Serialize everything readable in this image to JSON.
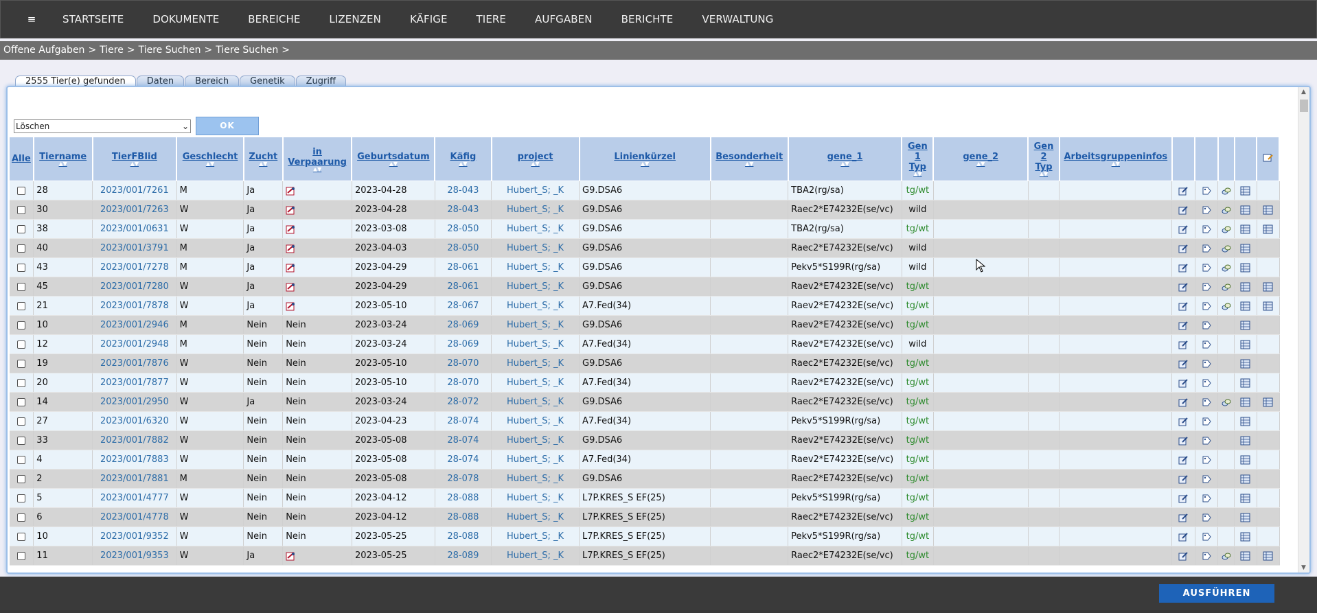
{
  "topnav": {
    "menu_icon": "≡",
    "items": [
      "STARTSEITE",
      "DOKUMENTE",
      "BEREICHE",
      "LIZENZEN",
      "KÄFIGE",
      "TIERE",
      "AUFGABEN",
      "BERICHTE",
      "VERWALTUNG"
    ]
  },
  "breadcrumb": [
    "Offene Aufgaben",
    "Tiere",
    "Tiere Suchen",
    "Tiere Suchen"
  ],
  "breadcrumb_sep": ">",
  "tabs": [
    "2555 Tier(e) gefunden",
    "Daten",
    "Bereich",
    "Genetik",
    "Zugriff"
  ],
  "action": {
    "selected": "Löschen",
    "ok_label": "OK"
  },
  "table": {
    "headers": [
      "Alle",
      "Tiername",
      "TierFBIid",
      "Geschlecht",
      "Zucht",
      "in Verpaarung",
      "Geburtsdatum",
      "Käfig",
      "project",
      "Linienkürzel",
      "Besonderheit",
      "gene_1",
      "Gen 1 Typ",
      "gene_2",
      "Gen 2 Typ",
      "Arbeitsgruppeninfos"
    ],
    "rows": [
      {
        "name": "28",
        "id": "2023/001/7261",
        "sex": "M",
        "zucht": "Ja",
        "verp": "icon",
        "birth": "2023-04-28",
        "cage": "28-043",
        "project": "Hubert_S; _K",
        "line": "G9.DSA6",
        "gene1": "TBA2(rg/sa)",
        "typ1": "tg/wt",
        "icons": 4
      },
      {
        "name": "30",
        "id": "2023/001/7263",
        "sex": "W",
        "zucht": "Ja",
        "verp": "icon",
        "birth": "2023-04-28",
        "cage": "28-043",
        "project": "Hubert_S; _K",
        "line": "G9.DSA6",
        "gene1": "Raec2*E74232E(se/vc)",
        "typ1": "wild",
        "icons": 5
      },
      {
        "name": "38",
        "id": "2023/001/0631",
        "sex": "W",
        "zucht": "Ja",
        "verp": "icon",
        "birth": "2023-03-08",
        "cage": "28-050",
        "project": "Hubert_S; _K",
        "line": "G9.DSA6",
        "gene1": "TBA2(rg/sa)",
        "typ1": "tg/wt",
        "icons": 5
      },
      {
        "name": "40",
        "id": "2023/001/3791",
        "sex": "M",
        "zucht": "Ja",
        "verp": "icon",
        "birth": "2023-04-03",
        "cage": "28-050",
        "project": "Hubert_S; _K",
        "line": "G9.DSA6",
        "gene1": "Raec2*E74232E(se/vc)",
        "typ1": "wild",
        "icons": 4
      },
      {
        "name": "43",
        "id": "2023/001/7278",
        "sex": "M",
        "zucht": "Ja",
        "verp": "icon",
        "birth": "2023-04-29",
        "cage": "28-061",
        "project": "Hubert_S; _K",
        "line": "G9.DSA6",
        "gene1": "Pekv5*S199R(rg/sa)",
        "typ1": "wild",
        "icons": 4
      },
      {
        "name": "45",
        "id": "2023/001/7280",
        "sex": "W",
        "zucht": "Ja",
        "verp": "icon",
        "birth": "2023-04-29",
        "cage": "28-061",
        "project": "Hubert_S; _K",
        "line": "G9.DSA6",
        "gene1": "Raev2*E74232E(se/vc)",
        "typ1": "tg/wt",
        "icons": 5
      },
      {
        "name": "21",
        "id": "2023/001/7878",
        "sex": "W",
        "zucht": "Ja",
        "verp": "icon",
        "birth": "2023-05-10",
        "cage": "28-067",
        "project": "Hubert_S; _K",
        "line": "A7.Fed(34)",
        "gene1": "Raev2*E74232E(se/vc)",
        "typ1": "tg/wt",
        "icons": 5
      },
      {
        "name": "10",
        "id": "2023/001/2946",
        "sex": "M",
        "zucht": "Nein",
        "verp": "Nein",
        "birth": "2023-03-24",
        "cage": "28-069",
        "project": "Hubert_S; _K",
        "line": "G9.DSA6",
        "gene1": "Raev2*E74232E(se/vc)",
        "typ1": "tg/wt",
        "icons": 3
      },
      {
        "name": "12",
        "id": "2023/001/2948",
        "sex": "M",
        "zucht": "Nein",
        "verp": "Nein",
        "birth": "2023-03-24",
        "cage": "28-069",
        "project": "Hubert_S; _K",
        "line": "A7.Fed(34)",
        "gene1": "Raev2*E74232E(se/vc)",
        "typ1": "wild",
        "icons": 3
      },
      {
        "name": "19",
        "id": "2023/001/7876",
        "sex": "W",
        "zucht": "Nein",
        "verp": "Nein",
        "birth": "2023-05-10",
        "cage": "28-070",
        "project": "Hubert_S; _K",
        "line": "G9.DSA6",
        "gene1": "Raec2*E74232E(se/vc)",
        "typ1": "tg/wt",
        "icons": 3
      },
      {
        "name": "20",
        "id": "2023/001/7877",
        "sex": "W",
        "zucht": "Nein",
        "verp": "Nein",
        "birth": "2023-05-10",
        "cage": "28-070",
        "project": "Hubert_S; _K",
        "line": "A7.Fed(34)",
        "gene1": "Raev2*E74232E(se/vc)",
        "typ1": "tg/wt",
        "icons": 3
      },
      {
        "name": "14",
        "id": "2023/001/2950",
        "sex": "W",
        "zucht": "Ja",
        "verp": "Nein",
        "birth": "2023-03-24",
        "cage": "28-072",
        "project": "Hubert_S; _K",
        "line": "G9.DSA6",
        "gene1": "Raec2*E74232E(se/vc)",
        "typ1": "tg/wt",
        "icons": 5
      },
      {
        "name": "27",
        "id": "2023/001/6320",
        "sex": "W",
        "zucht": "Nein",
        "verp": "Nein",
        "birth": "2023-04-23",
        "cage": "28-074",
        "project": "Hubert_S; _K",
        "line": "A7.Fed(34)",
        "gene1": "Pekv5*S199R(rg/sa)",
        "typ1": "tg/wt",
        "icons": 3
      },
      {
        "name": "33",
        "id": "2023/001/7882",
        "sex": "W",
        "zucht": "Nein",
        "verp": "Nein",
        "birth": "2023-05-08",
        "cage": "28-074",
        "project": "Hubert_S; _K",
        "line": "G9.DSA6",
        "gene1": "Raev2*E74232E(se/vc)",
        "typ1": "tg/wt",
        "icons": 3
      },
      {
        "name": "4",
        "id": "2023/001/7883",
        "sex": "W",
        "zucht": "Nein",
        "verp": "Nein",
        "birth": "2023-05-08",
        "cage": "28-074",
        "project": "Hubert_S; _K",
        "line": "A7.Fed(34)",
        "gene1": "Raev2*E74232E(se/vc)",
        "typ1": "tg/wt",
        "icons": 3
      },
      {
        "name": "2",
        "id": "2023/001/7881",
        "sex": "M",
        "zucht": "Nein",
        "verp": "Nein",
        "birth": "2023-05-08",
        "cage": "28-078",
        "project": "Hubert_S; _K",
        "line": "G9.DSA6",
        "gene1": "Raec2*E74232E(se/vc)",
        "typ1": "tg/wt",
        "icons": 3
      },
      {
        "name": "5",
        "id": "2023/001/4777",
        "sex": "W",
        "zucht": "Nein",
        "verp": "Nein",
        "birth": "2023-04-12",
        "cage": "28-088",
        "project": "Hubert_S; _K",
        "line": "L7P.KRES_S EF(25)",
        "gene1": "Pekv5*S199R(rg/sa)",
        "typ1": "tg/wt",
        "icons": 3
      },
      {
        "name": "6",
        "id": "2023/001/4778",
        "sex": "W",
        "zucht": "Nein",
        "verp": "Nein",
        "birth": "2023-04-12",
        "cage": "28-088",
        "project": "Hubert_S; _K",
        "line": "L7P.KRES_S EF(25)",
        "gene1": "Raec2*E74232E(se/vc)",
        "typ1": "tg/wt",
        "icons": 3
      },
      {
        "name": "10",
        "id": "2023/001/9352",
        "sex": "W",
        "zucht": "Nein",
        "verp": "Nein",
        "birth": "2023-05-25",
        "cage": "28-088",
        "project": "Hubert_S; _K",
        "line": "L7P.KRES_S EF(25)",
        "gene1": "Pekv5*S199R(rg/sa)",
        "typ1": "tg/wt",
        "icons": 3
      },
      {
        "name": "11",
        "id": "2023/001/9353",
        "sex": "W",
        "zucht": "Ja",
        "verp": "icon",
        "birth": "2023-05-25",
        "cage": "28-089",
        "project": "Hubert_S; _K",
        "line": "L7P.KRES_S EF(25)",
        "gene1": "Raec2*E74232E(se/vc)",
        "typ1": "tg/wt",
        "icons": 5
      }
    ]
  },
  "footer": {
    "run_label": "AUSFÜHREN"
  },
  "colors": {
    "accent": "#1e63b8",
    "link": "#2c6ca8",
    "green": "#2e8b2e",
    "header_bg": "#b9cde9"
  }
}
